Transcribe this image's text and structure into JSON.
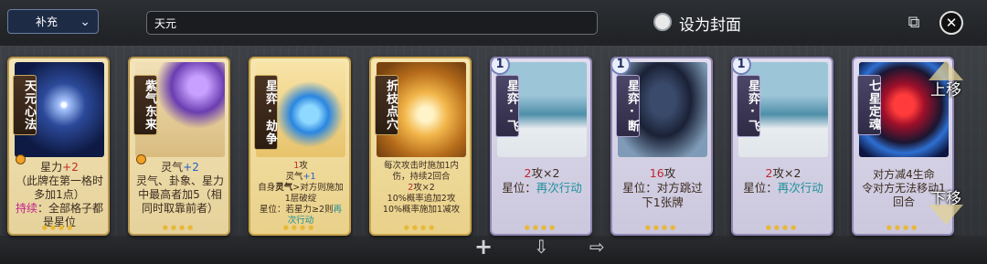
{
  "header": {
    "deck_select": "补充",
    "deck_name": "天元",
    "cover_label": "设为封面"
  },
  "cards": [
    {
      "title": "天元心法",
      "desc_html": "星力<span class='r'>+2</span><br>（此牌在第一格时多加1点）<br><span class='p'>持续</span>：全部格子都是星位"
    },
    {
      "title": "紫气东来",
      "desc_html": "灵气<span class='b'>+2</span><br>灵气、卦象、星力中最高者加5（相同时取靠前者）"
    },
    {
      "title": "星弈·劫争",
      "desc_html": "<span class='r'>1</span>攻<br>灵气<span class='b'>+1</span><br>自身<b>灵气</b>&gt;对方则施加1层破绽<br>星位：若星力≥2则<span class='t'>再次行动</span>"
    },
    {
      "title": "折枝点穴",
      "desc_html": "每次攻击时施加1内伤，持续2回合<br><span class='r'>2</span>攻×2<br>10%概率追加2攻<br>10%概率施加1减攻"
    },
    {
      "title": "星弈·飞",
      "badge": "1",
      "desc_html": "<span class='r'>2</span>攻×2<br>星位：<span class='t'>再次行动</span>"
    },
    {
      "title": "星弈·断",
      "badge": "1",
      "desc_html": "<span class='r'>16</span>攻<br>星位：对方跳过下1张牌"
    },
    {
      "title": "星弈·飞",
      "badge": "1",
      "desc_html": "<span class='r'>2</span>攻×2<br>星位：<span class='t'>再次行动</span>"
    },
    {
      "title": "七星定魂",
      "desc_html": "对方减4生命<br>令对方无法移动1回合"
    }
  ],
  "overlay": {
    "up_label": "上移",
    "down_label": "下移"
  },
  "colors": {
    "attack": "#c0272d",
    "qi": "#2460c6",
    "persist": "#c51f8e",
    "act_again": "#1d8f9a"
  },
  "icons": [
    "chevron-down-icon",
    "radio-icon",
    "copy-icon",
    "close-icon",
    "add-icon",
    "import-icon",
    "export-icon"
  ]
}
